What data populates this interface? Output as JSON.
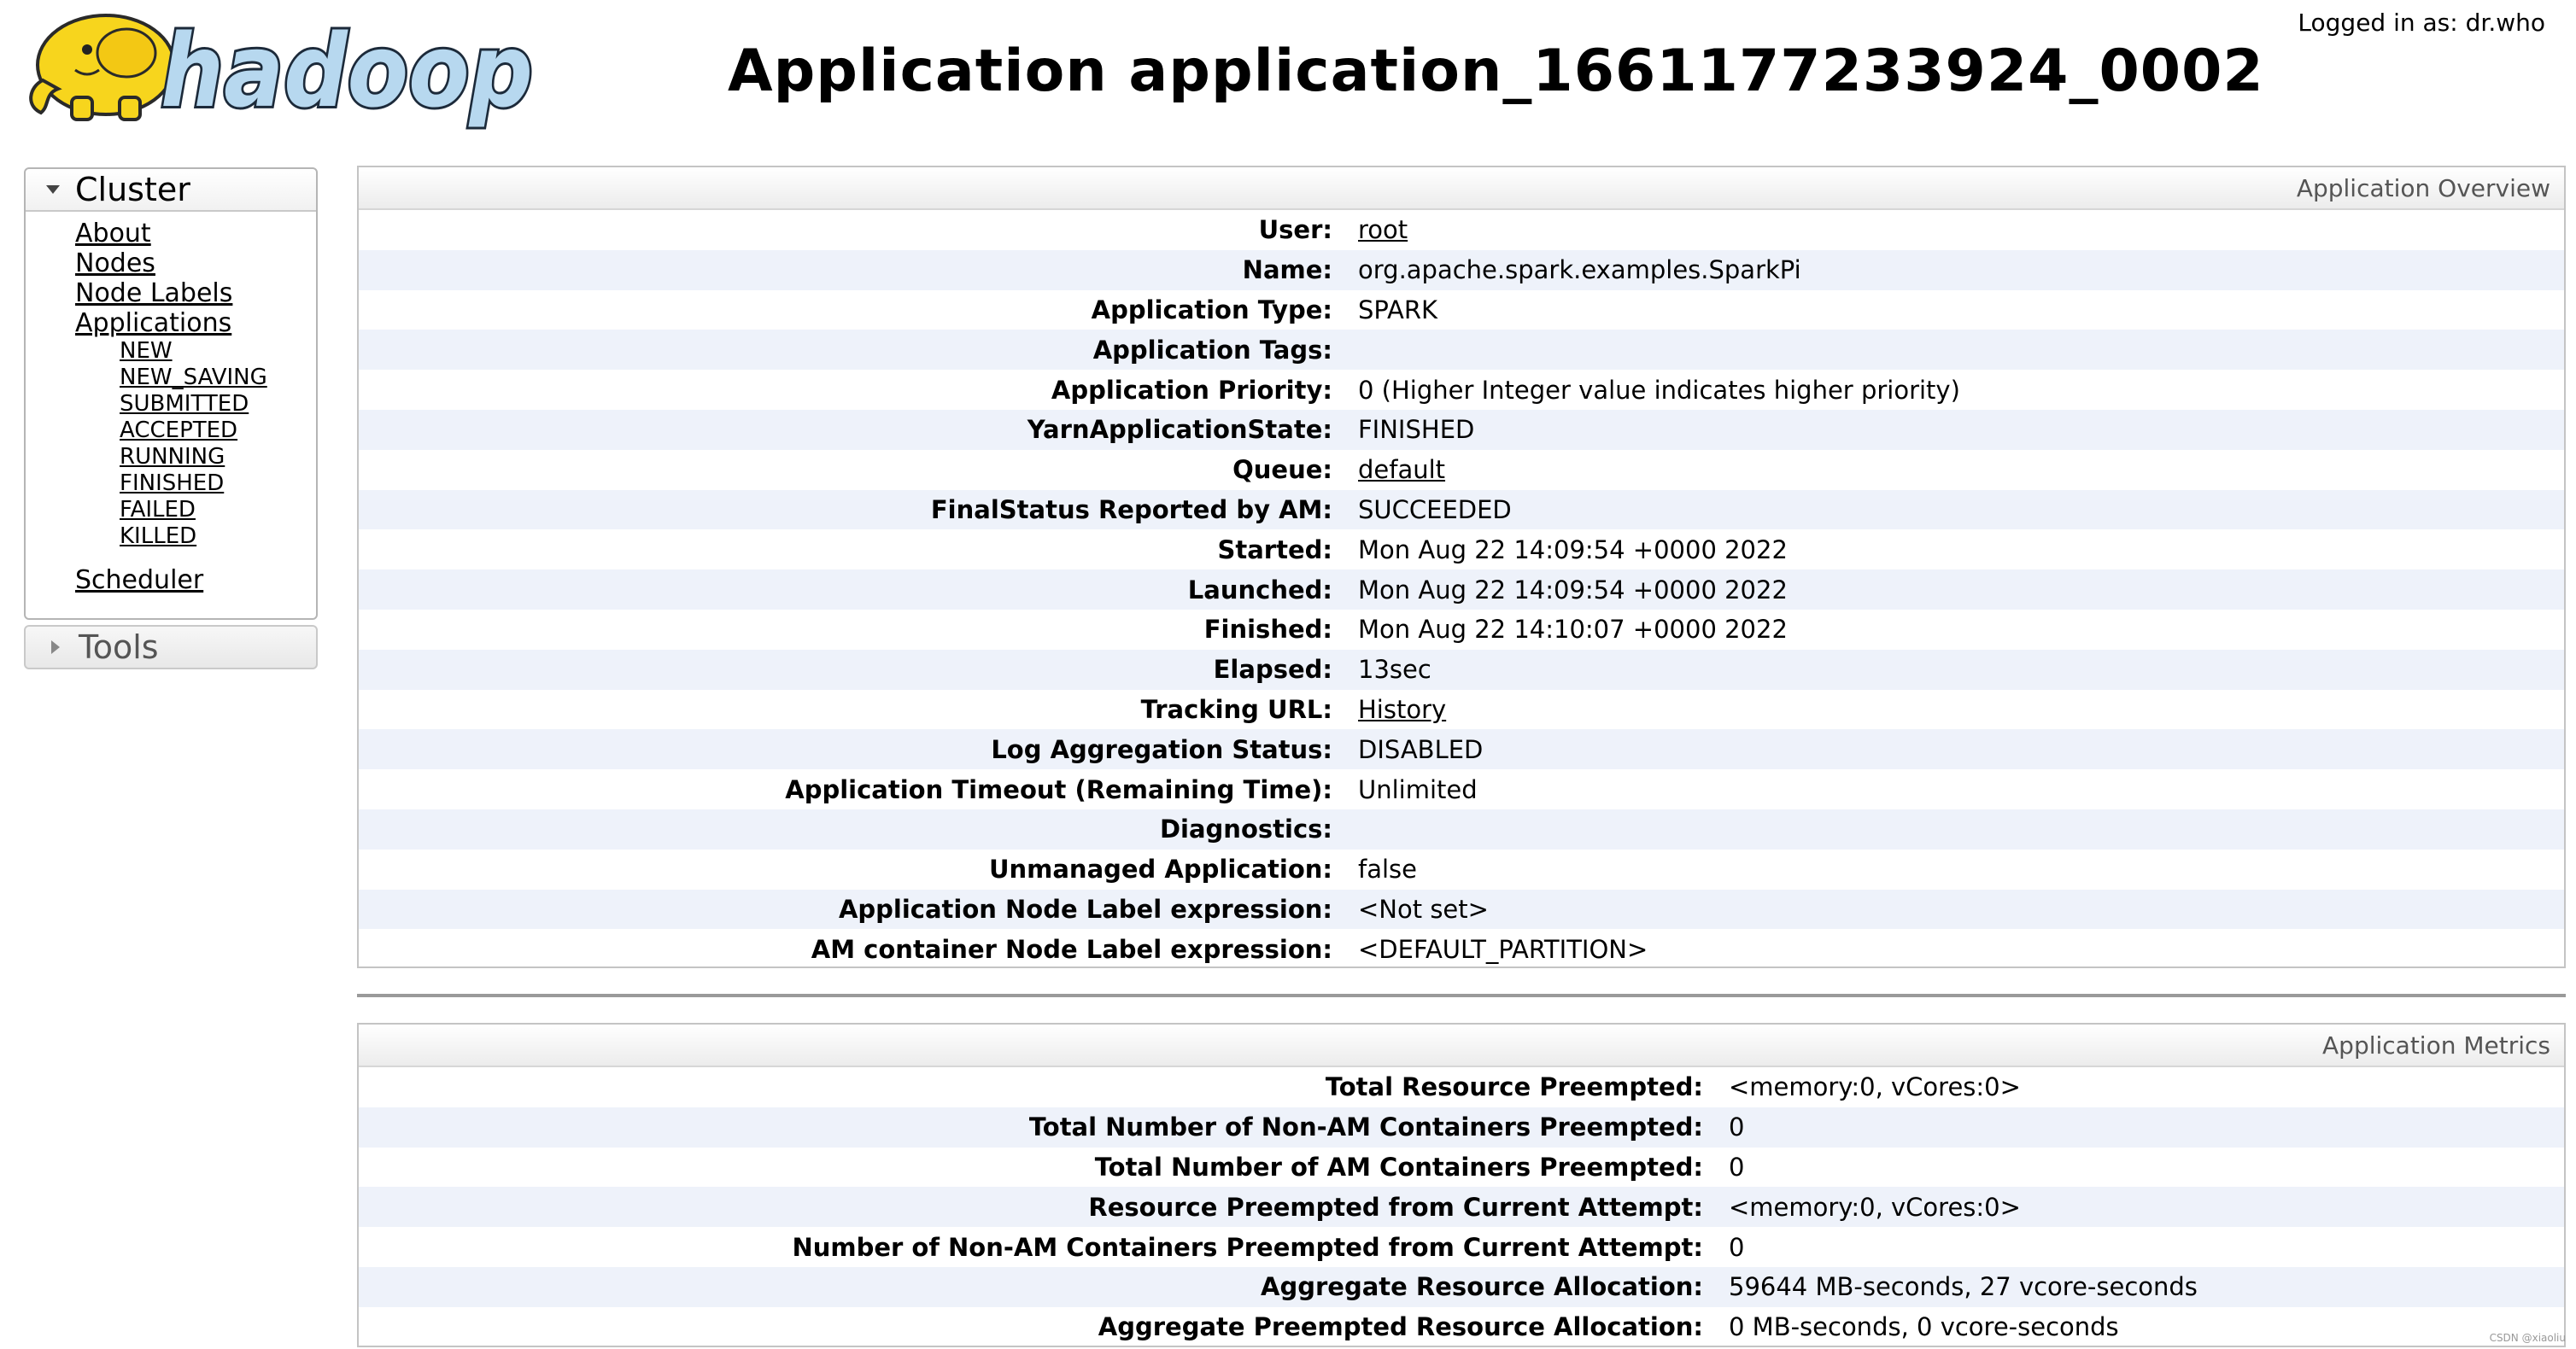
{
  "header": {
    "logo_text": "hadoop",
    "logged_in": "Logged in as: dr.who",
    "title": "Application application_1661177233924_0002"
  },
  "sidebar": {
    "cluster": {
      "title": "Cluster",
      "links": [
        "About",
        "Nodes",
        "Node Labels",
        "Applications"
      ],
      "app_states": [
        "NEW",
        "NEW_SAVING",
        "SUBMITTED",
        "ACCEPTED",
        "RUNNING",
        "FINISHED",
        "FAILED",
        "KILLED"
      ],
      "scheduler": "Scheduler"
    },
    "tools": {
      "title": "Tools"
    }
  },
  "overview": {
    "title": "Application Overview",
    "rows": [
      {
        "key": "User:",
        "value": "root",
        "link": true
      },
      {
        "key": "Name:",
        "value": "org.apache.spark.examples.SparkPi",
        "link": false
      },
      {
        "key": "Application Type:",
        "value": "SPARK",
        "link": false
      },
      {
        "key": "Application Tags:",
        "value": "",
        "link": false
      },
      {
        "key": "Application Priority:",
        "value": "0 (Higher Integer value indicates higher priority)",
        "link": false
      },
      {
        "key": "YarnApplicationState:",
        "value": "FINISHED",
        "link": false
      },
      {
        "key": "Queue:",
        "value": "default",
        "link": true
      },
      {
        "key": "FinalStatus Reported by AM:",
        "value": "SUCCEEDED",
        "link": false
      },
      {
        "key": "Started:",
        "value": "Mon Aug 22 14:09:54 +0000 2022",
        "link": false
      },
      {
        "key": "Launched:",
        "value": "Mon Aug 22 14:09:54 +0000 2022",
        "link": false
      },
      {
        "key": "Finished:",
        "value": "Mon Aug 22 14:10:07 +0000 2022",
        "link": false
      },
      {
        "key": "Elapsed:",
        "value": "13sec",
        "link": false
      },
      {
        "key": "Tracking URL:",
        "value": "History",
        "link": true
      },
      {
        "key": "Log Aggregation Status:",
        "value": "DISABLED",
        "link": false
      },
      {
        "key": "Application Timeout (Remaining Time):",
        "value": "Unlimited",
        "link": false
      },
      {
        "key": "Diagnostics:",
        "value": "",
        "link": false
      },
      {
        "key": "Unmanaged Application:",
        "value": "false",
        "link": false
      },
      {
        "key": "Application Node Label expression:",
        "value": "<Not set>",
        "link": false
      },
      {
        "key": "AM container Node Label expression:",
        "value": "<DEFAULT_PARTITION>",
        "link": false
      }
    ]
  },
  "metrics": {
    "title": "Application Metrics",
    "rows": [
      {
        "key": "Total Resource Preempted:",
        "value": "<memory:0, vCores:0>"
      },
      {
        "key": "Total Number of Non-AM Containers Preempted:",
        "value": "0"
      },
      {
        "key": "Total Number of AM Containers Preempted:",
        "value": "0"
      },
      {
        "key": "Resource Preempted from Current Attempt:",
        "value": "<memory:0, vCores:0>"
      },
      {
        "key": "Number of Non-AM Containers Preempted from Current Attempt:",
        "value": "0"
      },
      {
        "key": "Aggregate Resource Allocation:",
        "value": "59644 MB-seconds, 27 vcore-seconds"
      },
      {
        "key": "Aggregate Preempted Resource Allocation:",
        "value": "0 MB-seconds, 0 vcore-seconds"
      }
    ]
  },
  "watermark": "CSDN @xiaoliu",
  "colors": {
    "logo_yellow": "#f7d51d",
    "logo_blue": "#b7d8ef",
    "row_stripe": "#eef2fa"
  }
}
